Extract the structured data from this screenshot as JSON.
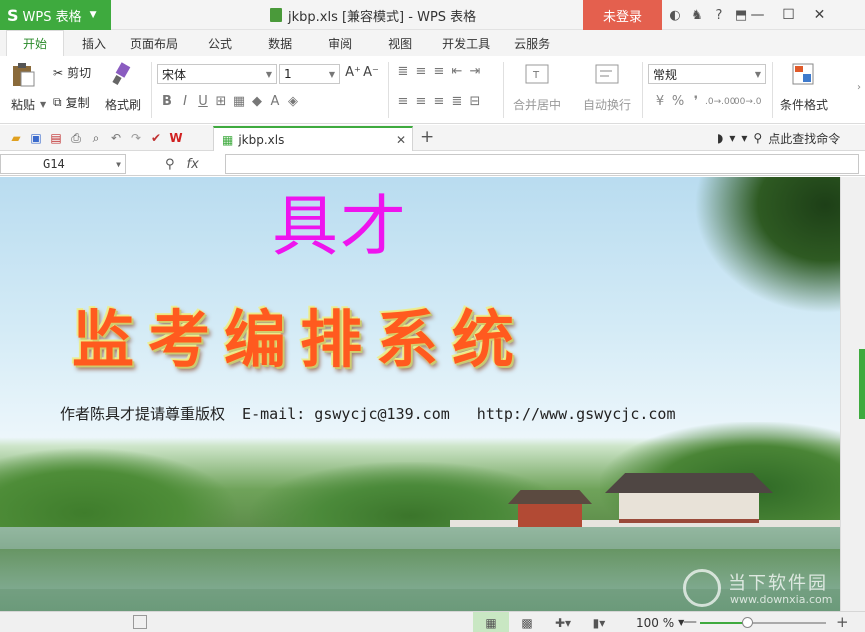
{
  "titlebar": {
    "app_button_letter": "S",
    "app_button_label": "WPS 表格",
    "doc_title": "jkbp.xls [兼容模式] - WPS 表格",
    "login_label": "未登录",
    "icons": [
      "skin-icon",
      "shirt-icon",
      "help-icon",
      "fullscreen-icon"
    ],
    "help_label": "?"
  },
  "ribbon_tabs": [
    "开始",
    "插入",
    "页面布局",
    "公式",
    "数据",
    "审阅",
    "视图",
    "开发工具",
    "云服务"
  ],
  "ribbon": {
    "paste": "粘贴",
    "cut": "剪切",
    "copy": "复制",
    "format_painter": "格式刷",
    "font_name": "宋体",
    "font_size": "1",
    "merge_center": "合并居中",
    "wrap_text": "自动换行",
    "number_format": "常规",
    "percent": "%",
    "comma": "❜",
    "conditional_format": "条件格式"
  },
  "quickbar": {
    "doc_tab_label": "jkbp.xls",
    "search_label": "点此查找命令"
  },
  "formula_bar": {
    "name_box": "G14",
    "fx": "fx",
    "value": ""
  },
  "sheet": {
    "big_name": "具才",
    "title_art": "监考编排系统",
    "credit": "作者陈具才提请尊重版权",
    "email": "E-mail: gswycjc@139.com",
    "url": "http://www.gswycjc.com"
  },
  "status": {
    "zoom_label": "100 %",
    "zoom_percent": 100
  },
  "watermark": {
    "text": "当下软件园",
    "url": "www.downxia.com"
  },
  "colors": {
    "wps_green": "#3eaa3e",
    "login_red": "#e4604e",
    "title_magenta": "#ee14ee",
    "title_orange": "#ff5a1f"
  }
}
